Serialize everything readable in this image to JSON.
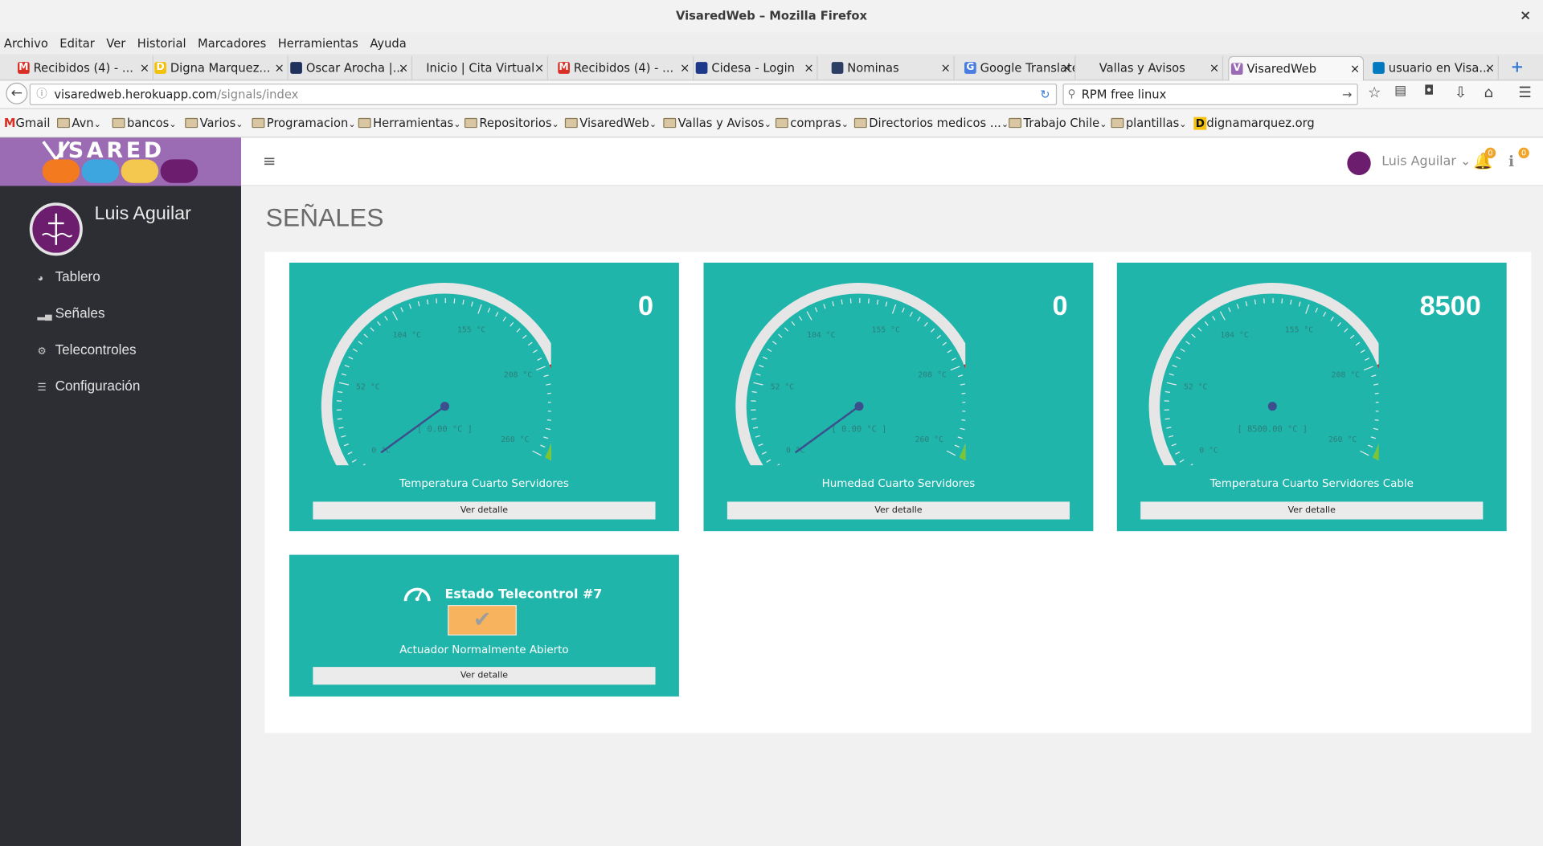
{
  "window": {
    "title": "VisaredWeb – Mozilla Firefox",
    "close": "×"
  },
  "menu": [
    "Archivo",
    "Editar",
    "Ver",
    "Historial",
    "Marcadores",
    "Herramientas",
    "Ayuda"
  ],
  "tabs": [
    {
      "label": "Recibidos (4) - ...",
      "icon": "gmail-icon",
      "color": "#d93025",
      "glyph": "M"
    },
    {
      "label": "Digna Marquez...",
      "icon": "d-logo-icon",
      "color": "#f4c20d",
      "glyph": "D"
    },
    {
      "label": "Oscar Arocha |...",
      "icon": "profile-icon",
      "color": "#20315e",
      "glyph": ""
    },
    {
      "label": "Inicio | Cita Virtual",
      "icon": "",
      "color": "",
      "glyph": ""
    },
    {
      "label": "Recibidos (4) - ...",
      "icon": "gmail-icon",
      "color": "#d93025",
      "glyph": "M"
    },
    {
      "label": "Cidesa - Login",
      "icon": "cidesa-icon",
      "color": "#1d3a8a",
      "glyph": ""
    },
    {
      "label": "Nominas",
      "icon": "nominas-icon",
      "color": "#2c3e63",
      "glyph": ""
    },
    {
      "label": "Google Translate",
      "icon": "translate-icon",
      "color": "#4a7de0",
      "glyph": "G"
    },
    {
      "label": "Vallas y Avisos",
      "icon": "",
      "color": "",
      "glyph": ""
    },
    {
      "label": "VisaredWeb",
      "icon": "visared-icon",
      "color": "#9b6bb4",
      "glyph": "V"
    },
    {
      "label": "usuario en Visa...",
      "icon": "trello-icon",
      "color": "#0079bf",
      "glyph": ""
    }
  ],
  "tab_close": "×",
  "new_tab": "+",
  "nav": {
    "back": "←",
    "url_host": "visaredweb.herokuapp.com",
    "url_path": "/signals/index",
    "reload": "↻",
    "search_value": "RPM free linux",
    "search_go": "→"
  },
  "bookmarks": [
    {
      "label": "Gmail",
      "type": "gmail"
    },
    {
      "label": "Avn",
      "type": "folder"
    },
    {
      "label": "bancos",
      "type": "folder"
    },
    {
      "label": "Varios",
      "type": "folder"
    },
    {
      "label": "Programacion",
      "type": "folder"
    },
    {
      "label": "Herramientas",
      "type": "folder"
    },
    {
      "label": "Repositorios",
      "type": "folder"
    },
    {
      "label": "VisaredWeb",
      "type": "folder"
    },
    {
      "label": "Vallas y Avisos",
      "type": "folder"
    },
    {
      "label": "compras",
      "type": "folder"
    },
    {
      "label": "Directorios medicos ...",
      "type": "folder"
    },
    {
      "label": "Trabajo Chile",
      "type": "folder"
    },
    {
      "label": "plantillas",
      "type": "folder"
    },
    {
      "label": "dignamarquez.org",
      "type": "site"
    }
  ],
  "brand": {
    "logo_text": "ISARED"
  },
  "sidebar": {
    "user": "Luis Aguilar",
    "items": [
      {
        "label": "Tablero",
        "icon": "dashboard-icon"
      },
      {
        "label": "Señales",
        "icon": "signal-icon"
      },
      {
        "label": "Telecontroles",
        "icon": "cogs-icon"
      },
      {
        "label": "Configuración",
        "icon": "sliders-icon"
      }
    ]
  },
  "topnav": {
    "user": "Luis Aguilar",
    "notif_count": "0",
    "info_count": "0"
  },
  "page_title": "SEÑALES",
  "gauges": [
    {
      "value": 0,
      "display": "0",
      "readout": "[ 0.00 °C ]",
      "label": "Temperatura Cuarto Servidores",
      "button": "Ver detalle"
    },
    {
      "value": 0,
      "display": "0",
      "readout": "[ 0.00 °C ]",
      "label": "Humedad Cuarto Servidores",
      "button": "Ver detalle"
    },
    {
      "value": 8500,
      "display": "8500",
      "readout": "[ 8500.00 °C ]",
      "label": "Temperatura Cuarto Servidores Cable",
      "button": "Ver detalle"
    }
  ],
  "gauge_scale": {
    "min": 0,
    "max": 260,
    "ticks": [
      "0 °C",
      "52 °C",
      "104 °C",
      "155 °C",
      "208 °C",
      "260 °C"
    ]
  },
  "telecontrol": {
    "title": "Estado Telecontrol #7",
    "subtitle": "Actuador Normalmente Abierto",
    "button": "Ver detalle",
    "state_icon": "check-icon",
    "state_color": "#f7b35d"
  },
  "colors": {
    "teal": "#20b5ab",
    "sidebar": "#2d2e34",
    "brand": "#9b6bb4"
  }
}
